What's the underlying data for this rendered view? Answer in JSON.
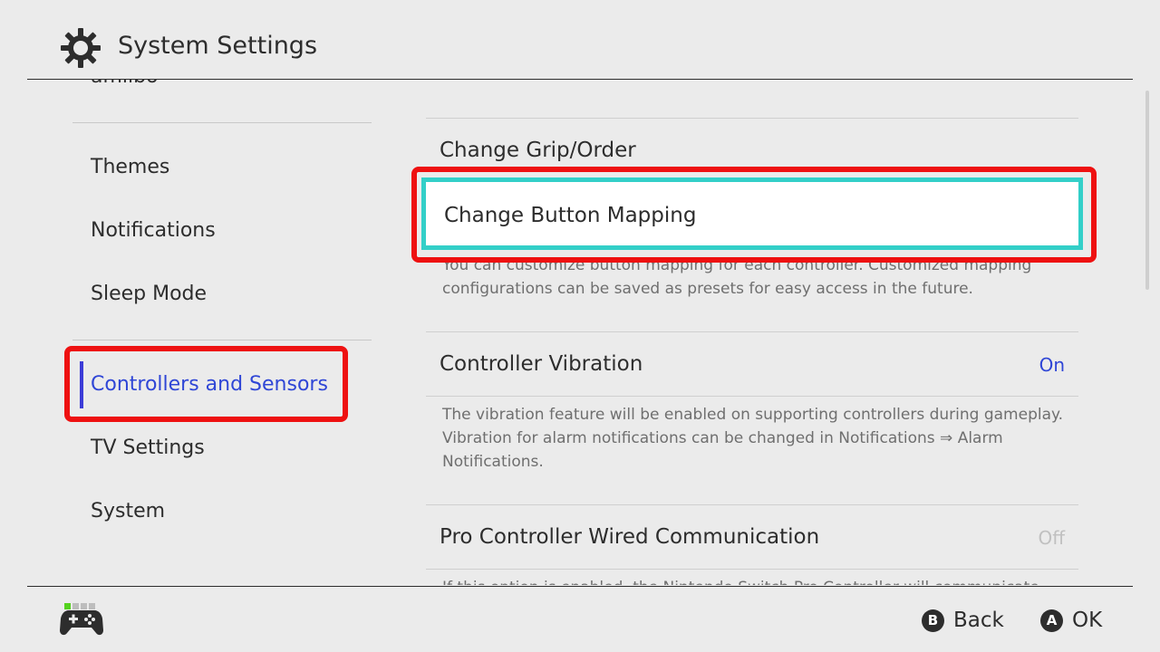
{
  "header": {
    "title": "System Settings",
    "icon": "gear-icon"
  },
  "sidebar": {
    "items": [
      {
        "label": "amiibo"
      },
      {
        "label": "Themes"
      },
      {
        "label": "Notifications"
      },
      {
        "label": "Sleep Mode"
      },
      {
        "label": "Controllers and Sensors",
        "selected": true
      },
      {
        "label": "TV Settings"
      },
      {
        "label": "System"
      }
    ]
  },
  "content": {
    "rows": [
      {
        "title": "Change Grip/Order"
      },
      {
        "title": "Change Button Mapping",
        "focused": true,
        "description": "You can customize button mapping for each controller. Customized mapping configurations can be saved as presets for easy access in the future."
      },
      {
        "title": "Controller Vibration",
        "value": "On",
        "description": "The vibration feature will be enabled on supporting controllers during gameplay. Vibration for alarm notifications can be changed in Notifications ⇒ Alarm Notifications."
      },
      {
        "title": "Pro Controller Wired Communication",
        "value": "Off",
        "description": "If this option is enabled, the Nintendo Switch Pro Controller will communicate"
      }
    ]
  },
  "footer": {
    "back": {
      "key": "B",
      "label": "Back"
    },
    "ok": {
      "key": "A",
      "label": "OK"
    },
    "controller_icon": "gamepad-icon"
  },
  "colors": {
    "background": "#ebebeb",
    "accent_blue": "#2f46d6",
    "focus_cyan": "#33cfc8",
    "annotation_red": "#ee1111",
    "off_gray": "#c0c0c0"
  }
}
